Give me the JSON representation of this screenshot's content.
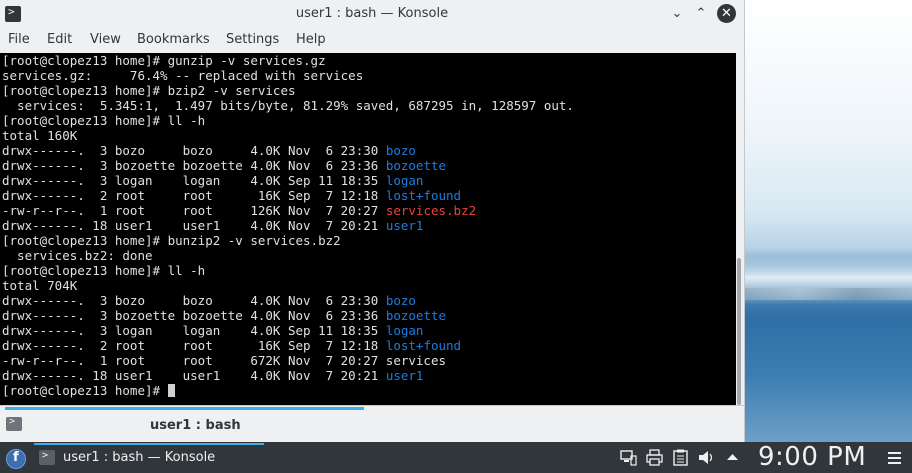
{
  "window": {
    "title": "user1 : bash — Konsole",
    "buttons": {
      "minimize": "⌄",
      "maximize": "⌃",
      "close": "✕"
    }
  },
  "menubar": {
    "items": [
      "File",
      "Edit",
      "View",
      "Bookmarks",
      "Settings",
      "Help"
    ]
  },
  "terminal": {
    "lines": [
      [
        {
          "text": "[root@clopez13 home]# gunzip -v services.gz"
        }
      ],
      [
        {
          "text": "services.gz:     76.4% -- replaced with services"
        }
      ],
      [
        {
          "text": "[root@clopez13 home]# bzip2 -v services"
        }
      ],
      [
        {
          "text": "  services:  5.345:1,  1.497 bits/byte, 81.29% saved, 687295 in, 128597 out."
        }
      ],
      [
        {
          "text": "[root@clopez13 home]# ll -h"
        }
      ],
      [
        {
          "text": "total 160K"
        }
      ],
      [
        {
          "text": "drwx------.  3 bozo     bozo     4.0K Nov  6 23:30 "
        },
        {
          "text": "bozo",
          "color": "blue"
        }
      ],
      [
        {
          "text": "drwx------.  3 bozoette bozoette 4.0K Nov  6 23:36 "
        },
        {
          "text": "bozoette",
          "color": "blue"
        }
      ],
      [
        {
          "text": "drwx------.  3 logan    logan    4.0K Sep 11 18:35 "
        },
        {
          "text": "logan",
          "color": "blue"
        }
      ],
      [
        {
          "text": "drwx------.  2 root     root      16K Sep  7 12:18 "
        },
        {
          "text": "lost+found",
          "color": "blue"
        }
      ],
      [
        {
          "text": "-rw-r--r--.  1 root     root     126K Nov  7 20:27 "
        },
        {
          "text": "services.bz2",
          "color": "red"
        }
      ],
      [
        {
          "text": "drwx------. 18 user1    user1    4.0K Nov  7 20:21 "
        },
        {
          "text": "user1",
          "color": "blue"
        }
      ],
      [
        {
          "text": "[root@clopez13 home]# bunzip2 -v services.bz2"
        }
      ],
      [
        {
          "text": "  services.bz2: done"
        }
      ],
      [
        {
          "text": "[root@clopez13 home]# ll -h"
        }
      ],
      [
        {
          "text": "total 704K"
        }
      ],
      [
        {
          "text": "drwx------.  3 bozo     bozo     4.0K Nov  6 23:30 "
        },
        {
          "text": "bozo",
          "color": "blue"
        }
      ],
      [
        {
          "text": "drwx------.  3 bozoette bozoette 4.0K Nov  6 23:36 "
        },
        {
          "text": "bozoette",
          "color": "blue"
        }
      ],
      [
        {
          "text": "drwx------.  3 logan    logan    4.0K Sep 11 18:35 "
        },
        {
          "text": "logan",
          "color": "blue"
        }
      ],
      [
        {
          "text": "drwx------.  2 root     root      16K Sep  7 12:18 "
        },
        {
          "text": "lost+found",
          "color": "blue"
        }
      ],
      [
        {
          "text": "-rw-r--r--.  1 root     root     672K Nov  7 20:27 services"
        }
      ],
      [
        {
          "text": "drwx------. 18 user1    user1    4.0K Nov  7 20:21 "
        },
        {
          "text": "user1",
          "color": "blue"
        }
      ],
      [
        {
          "text": "[root@clopez13 home]# "
        },
        {
          "cursor": true
        }
      ]
    ],
    "colors": {
      "blue": "#1d7ddc",
      "red": "#e8423e",
      "fg": "#e0e0e0",
      "bg": "#000000"
    }
  },
  "tabs": [
    {
      "label": "user1 : bash",
      "icon": "terminal-icon"
    }
  ],
  "panel": {
    "launcher_icon": "fedora-launcher-icon",
    "task": {
      "label": "user1 : bash — Konsole",
      "icon": "konsole-icon"
    },
    "tray": [
      "network-icon",
      "printer-icon",
      "clipboard-icon",
      "volume-icon",
      "expand-arrow-icon"
    ],
    "clock": "9:00 PM"
  },
  "accent": "#3daee9"
}
